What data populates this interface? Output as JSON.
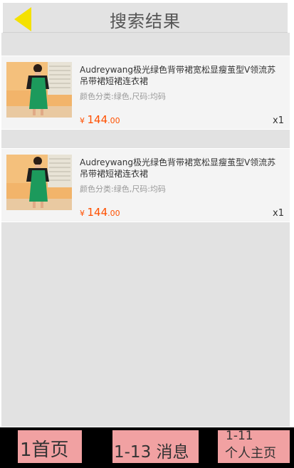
{
  "header": {
    "title": "搜索结果",
    "back_icon": "back-arrow-icon",
    "back_icon_color": "#f4e100"
  },
  "items": [
    {
      "title": "Audreywang极光绿色背带裙宽松显瘦茧型V领流苏吊带裙短裙连衣裙",
      "spec": "颜色分类:绿色,尺码:均码",
      "currency": "¥",
      "price_int": "144",
      "price_dec": ".00",
      "qty": "x1"
    },
    {
      "title": "Audreywang极光绿色背带裙宽松显瘦茧型V领流苏吊带裙短裙连衣裙",
      "spec": "颜色分类:绿色,尺码:均码",
      "currency": "¥",
      "price_int": "144",
      "price_dec": ".00",
      "qty": "x1"
    }
  ],
  "footer": {
    "home": "1首页",
    "messages": "1-13 消息",
    "profile_num": "1-11",
    "profile_label": "个人主页"
  },
  "colors": {
    "price": "#ff5000",
    "tab_bg": "#f1a1a2",
    "footer_bg": "#000000"
  }
}
